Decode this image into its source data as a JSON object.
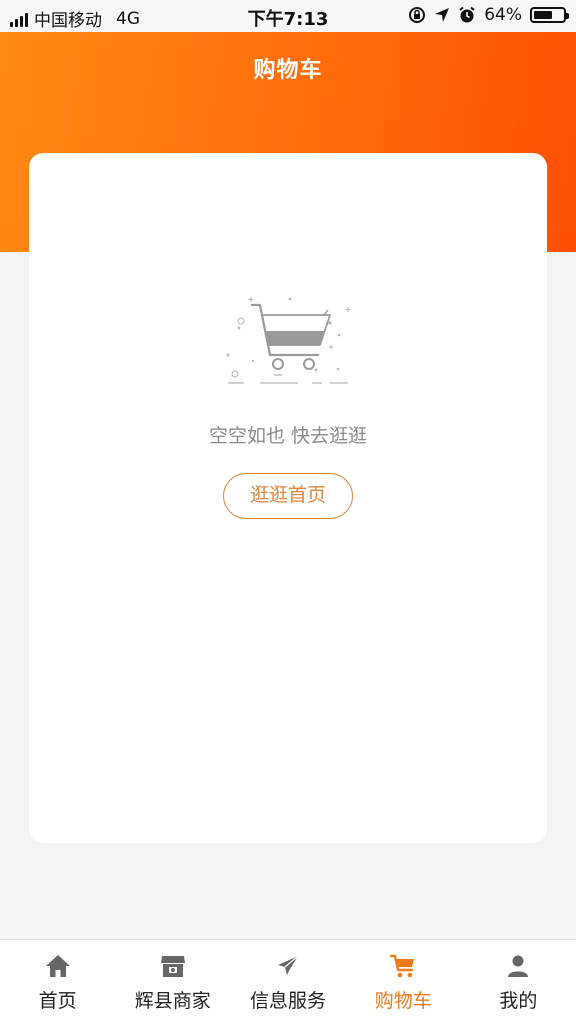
{
  "status_bar": {
    "carrier": "中国移动",
    "network": "4G",
    "time": "下午7:13",
    "battery_percent": "64%",
    "battery_level": 0.64
  },
  "header": {
    "title": "购物车"
  },
  "empty_state": {
    "message": "空空如也 快去逛逛",
    "button_label": "逛逛首页",
    "illustration_icon": "empty-cart-icon"
  },
  "tab_bar": {
    "active_color": "#f07a1c",
    "items": [
      {
        "label": "首页",
        "icon": "home-icon"
      },
      {
        "label": "辉县商家",
        "icon": "store-icon"
      },
      {
        "label": "信息服务",
        "icon": "paper-plane-icon"
      },
      {
        "label": "购物车",
        "icon": "cart-icon",
        "active": true
      },
      {
        "label": "我的",
        "icon": "user-icon"
      }
    ]
  },
  "colors": {
    "header_gradient_start": "#ff8a14",
    "header_gradient_end": "#ff4f05",
    "accent": "#e0863a"
  }
}
